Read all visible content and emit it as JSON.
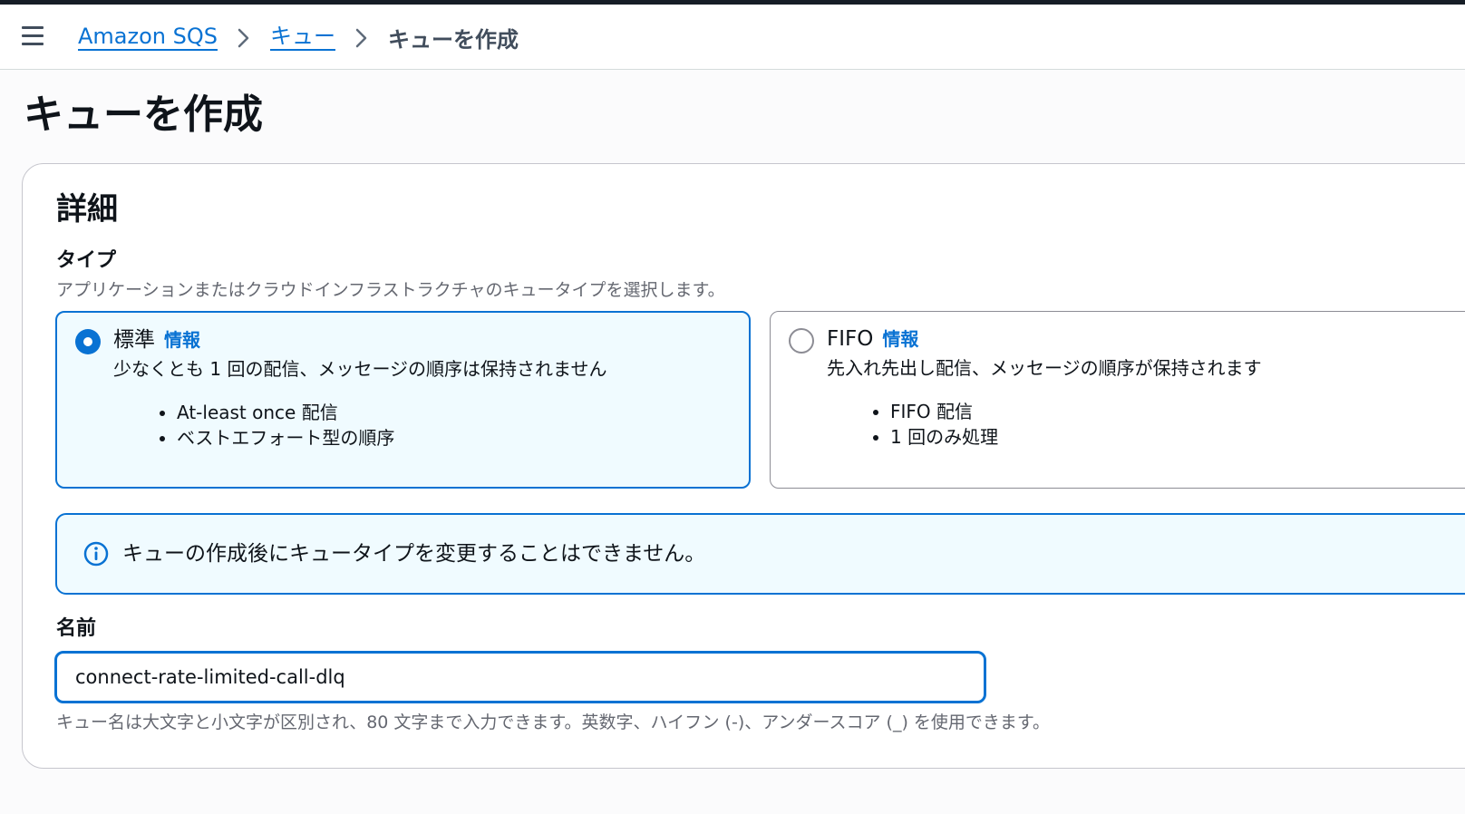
{
  "breadcrumb": {
    "service": "Amazon SQS",
    "queues": "キュー",
    "current": "キューを作成"
  },
  "page": {
    "title": "キューを作成"
  },
  "details": {
    "title": "詳細",
    "type": {
      "label": "タイプ",
      "description": "アプリケーションまたはクラウドインフラストラクチャのキュータイプを選択します。",
      "options": [
        {
          "title": "標準",
          "info": "情報",
          "description": "少なくとも 1 回の配信、メッセージの順序は保持されません",
          "bullets": [
            "At-least once 配信",
            "ベストエフォート型の順序"
          ],
          "selected": true
        },
        {
          "title": "FIFO",
          "info": "情報",
          "description": "先入れ先出し配信、メッセージの順序が保持されます",
          "bullets": [
            "FIFO 配信",
            "1 回のみ処理"
          ],
          "selected": false
        }
      ]
    },
    "alert": {
      "icon": "info-circle-icon",
      "text": "キューの作成後にキュータイプを変更することはできません。"
    },
    "name": {
      "label": "名前",
      "value": "connect-rate-limited-call-dlq",
      "hint": "キュー名は大文字と小文字が区別され、80 文字まで入力できます。英数字、ハイフン (-)、アンダースコア (_) を使用できます。"
    }
  },
  "colors": {
    "accent": "#0972d3",
    "selected_bg": "#f0fbff",
    "top_strip": "#161d26"
  }
}
